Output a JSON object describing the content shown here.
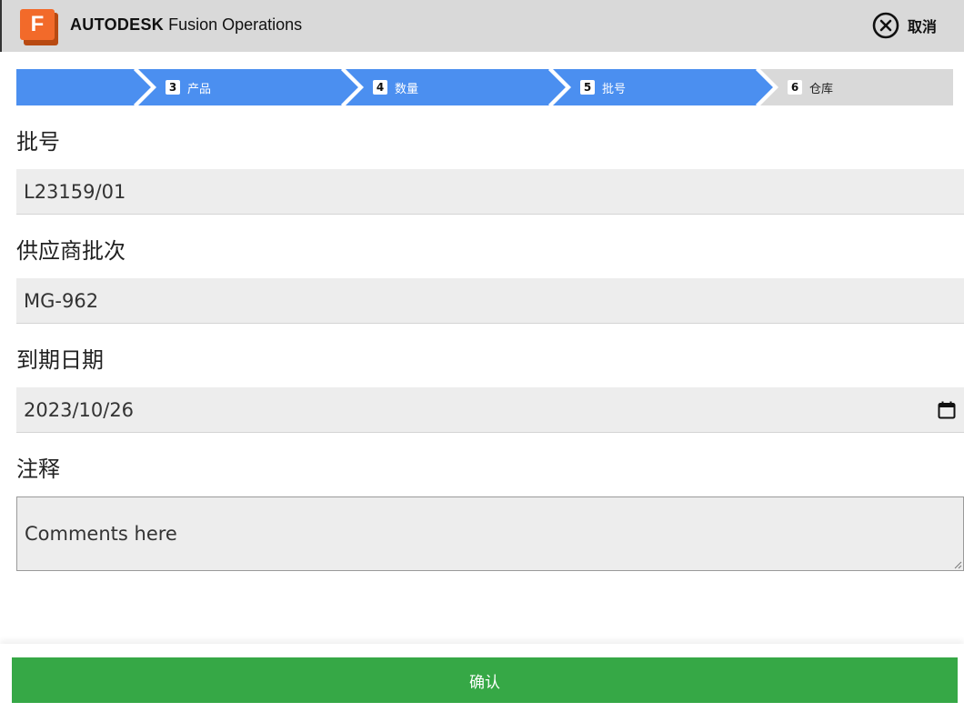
{
  "header": {
    "brand_bold": "AUTODESK",
    "brand_rest": " Fusion Operations",
    "logo_letter": "F",
    "cancel_label": "取消",
    "cancel_icon": "close-circle-icon"
  },
  "stepper": {
    "steps": [
      {
        "number": "",
        "label": "",
        "state": "done"
      },
      {
        "number": "3",
        "label": "产品",
        "state": "done"
      },
      {
        "number": "4",
        "label": "数量",
        "state": "done"
      },
      {
        "number": "5",
        "label": "批号",
        "state": "active"
      },
      {
        "number": "6",
        "label": "仓库",
        "state": "pending"
      }
    ],
    "active_color": "#4b8ff0",
    "pending_color": "#d9d9d9"
  },
  "form": {
    "batch": {
      "label": "批号",
      "value": "L23159/01"
    },
    "supplier_batch": {
      "label": "供应商批次",
      "value": "MG-962"
    },
    "expiry": {
      "label": "到期日期",
      "value": "2023/10/26",
      "icon": "calendar-icon"
    },
    "notes": {
      "label": "注释",
      "placeholder": "Comments here"
    }
  },
  "footer": {
    "confirm_label": "确认",
    "confirm_color": "#36a846"
  }
}
